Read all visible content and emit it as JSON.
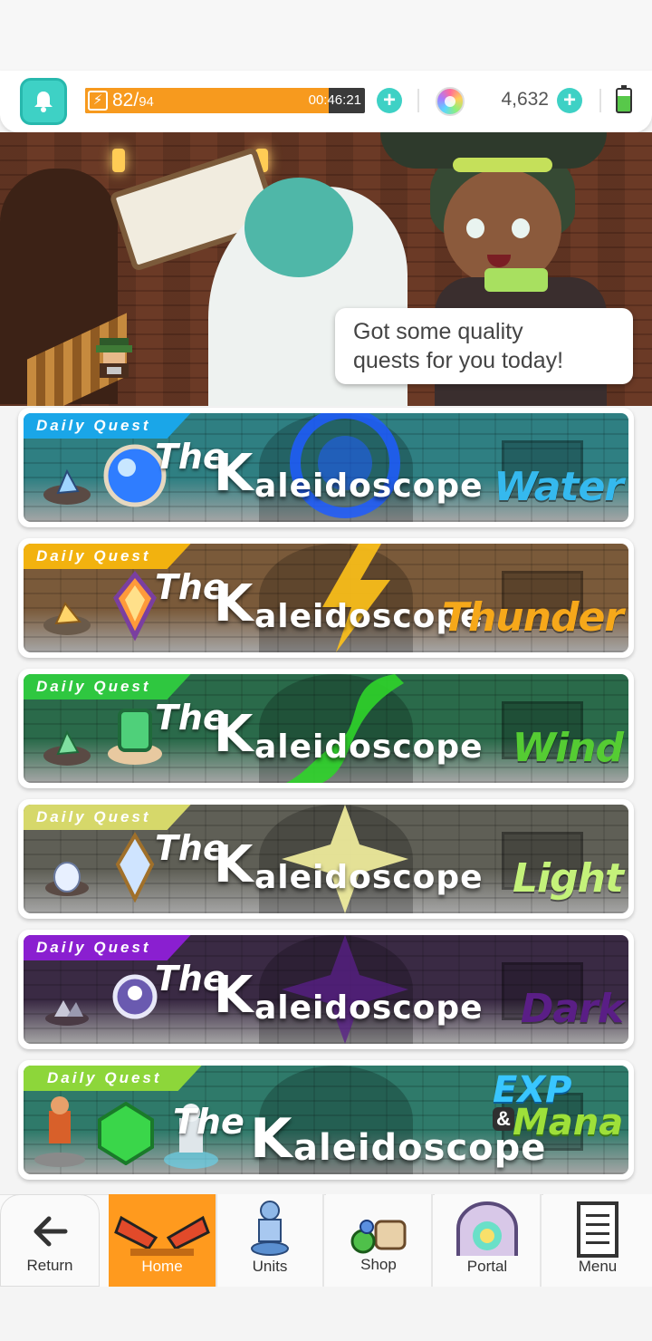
{
  "header": {
    "stamina_current": "82",
    "stamina_separator": "/",
    "stamina_max": "94",
    "stamina_fill_fraction": 0.87,
    "stamina_timer": "00:46:21",
    "gem_count": "4,632"
  },
  "hero": {
    "speech_line1": "Got some quality",
    "speech_line2": "quests for you today!"
  },
  "quests": [
    {
      "ribbon": "Daily Quest",
      "the": "The",
      "k": "K",
      "rest": "aleidoscope",
      "element": "Water",
      "ribbon_color": "#1aa6e8",
      "bg": "#2f7f82",
      "element_color": "#35b9ee",
      "glow": "#1f5cff",
      "orb_color": "#4aa3ff"
    },
    {
      "ribbon": "Daily Quest",
      "the": "The",
      "k": "K",
      "rest": "aleidoscope",
      "element": "Thunder",
      "ribbon_color": "#f2b20f",
      "bg": "#7a5a3a",
      "element_color": "#f6a81a",
      "glow": "#ffc21a",
      "orb_color": "#ffb04a"
    },
    {
      "ribbon": "Daily Quest",
      "the": "The",
      "k": "K",
      "rest": "aleidoscope",
      "element": "Wind",
      "ribbon_color": "#2fc740",
      "bg": "#2a6a4a",
      "element_color": "#55cc33",
      "glow": "#2fd42a",
      "orb_color": "#5ee08a"
    },
    {
      "ribbon": "Daily Quest",
      "the": "The",
      "k": "K",
      "rest": "aleidoscope",
      "element": "Light",
      "ribbon_color": "#d6d86a",
      "bg": "#5f5f56",
      "element_color": "#c4f27a",
      "glow": "#f5f2a0",
      "orb_color": "#cfe4ff"
    },
    {
      "ribbon": "Daily Quest",
      "the": "The",
      "k": "K",
      "rest": "aleidoscope",
      "element": "Dark",
      "ribbon_color": "#8a1fd0",
      "bg": "#3a2a44",
      "element_color": "#5a1e86",
      "glow": "#5a1f8a",
      "orb_color": "#c8c8e8"
    },
    {
      "ribbon": "Daily Quest",
      "the": "The",
      "k": "K",
      "rest": "aleidoscope",
      "element": "",
      "exp": "EXP",
      "amp": "&",
      "mana": "Mana",
      "ribbon_color": "#8dd63a",
      "bg": "#2f7a6a",
      "element_color": "#9ee03a",
      "glow": "#3ad6a8",
      "orb_color": "#47e05a"
    }
  ],
  "nav": {
    "return": "Return",
    "home": "Home",
    "units": "Units",
    "shop": "Shop",
    "portal": "Portal",
    "menu": "Menu"
  },
  "icons": {
    "bell": "bell-icon",
    "bolt": "lightning-icon",
    "plus": "plus-icon",
    "gem": "rainbow-gem-icon",
    "battery": "battery-icon"
  },
  "colors": {
    "accent": "#3ed1c5",
    "stamina": "#f79a1e",
    "home_tab": "#ff9a1e"
  }
}
